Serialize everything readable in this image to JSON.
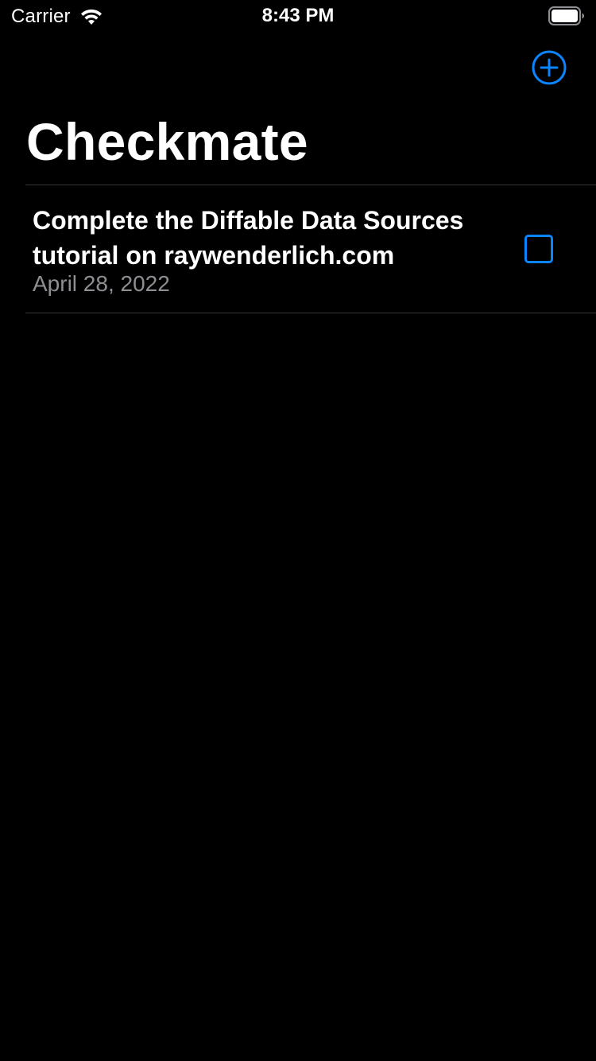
{
  "status_bar": {
    "carrier": "Carrier",
    "time": "8:43 PM",
    "wifi_icon": "wifi-icon",
    "battery_icon": "battery-icon"
  },
  "nav": {
    "add_icon": "plus-circle-icon",
    "title": "Checkmate"
  },
  "colors": {
    "background": "#000000",
    "accent": "#0a84ff",
    "text_primary": "#ffffff",
    "text_secondary": "#8e8e93",
    "separator": "#38383a"
  },
  "items": [
    {
      "title": "Complete the Diffable Data Sources tutorial on raywenderlich.com",
      "date": "April 28, 2022",
      "checked": false,
      "checkbox_icon": "unchecked-square-icon"
    }
  ]
}
